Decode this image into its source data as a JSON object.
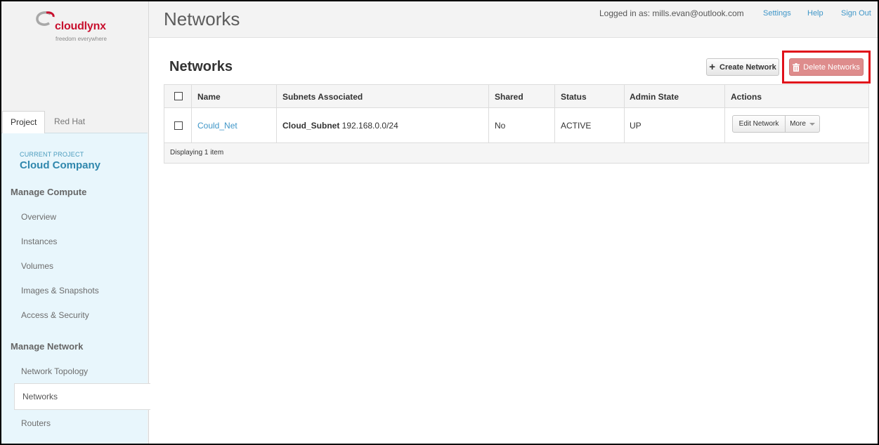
{
  "brand": {
    "name": "cloudlynx",
    "tagline": "freedom everywhere",
    "color": "#c8102e"
  },
  "header": {
    "title": "Networks",
    "logged_in": "Logged in as: mills.evan@outlook.com",
    "links": [
      "Settings",
      "Help",
      "Sign Out"
    ]
  },
  "sidebar": {
    "tabs": [
      "Project",
      "Red Hat"
    ],
    "current_project_label": "CURRENT PROJECT",
    "current_project": "Cloud Company",
    "sections": [
      {
        "title": "Manage Compute",
        "items": [
          "Overview",
          "Instances",
          "Volumes",
          "Images & Snapshots",
          "Access & Security"
        ]
      },
      {
        "title": "Manage Network",
        "items": [
          "Network Topology",
          "Networks",
          "Routers"
        ]
      }
    ],
    "active_item": "Networks"
  },
  "main": {
    "title": "Networks",
    "create_button": "Create Network",
    "delete_button": "Delete Networks",
    "table": {
      "columns": [
        "Name",
        "Subnets Associated",
        "Shared",
        "Status",
        "Admin State",
        "Actions"
      ],
      "rows": [
        {
          "name": "Could_Net",
          "subnet_name": "Cloud_Subnet",
          "subnet_cidr": "192.168.0.0/24",
          "shared": "No",
          "status": "ACTIVE",
          "admin_state": "UP",
          "action_primary": "Edit Network",
          "action_more": "More"
        }
      ],
      "footer": "Displaying 1 item"
    }
  },
  "colors": {
    "link": "#3f96c8",
    "delete_button": "#de8c8c",
    "highlight": "#e0101a",
    "sidebar_panel": "#e8f6fc"
  }
}
